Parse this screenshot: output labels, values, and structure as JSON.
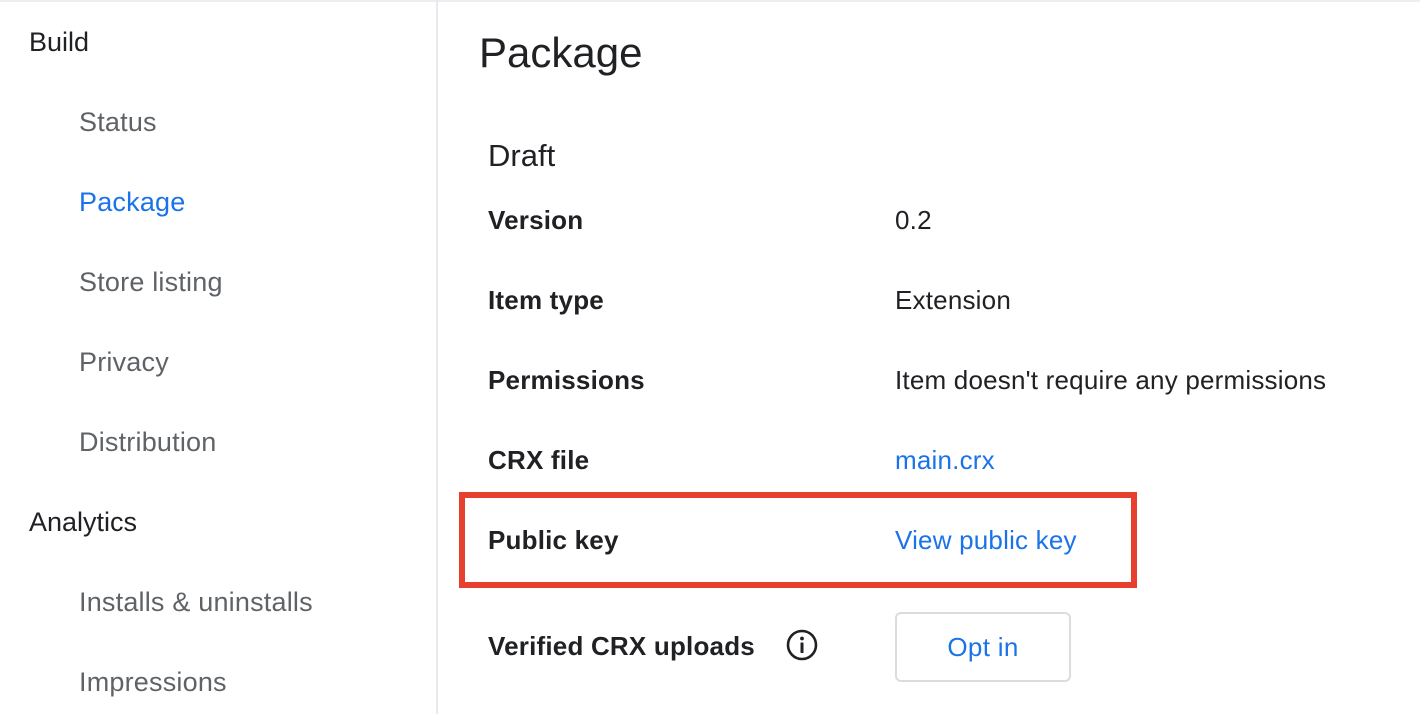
{
  "sidebar": {
    "sections": [
      {
        "label": "Build",
        "items": [
          {
            "label": "Status",
            "active": false
          },
          {
            "label": "Package",
            "active": true
          },
          {
            "label": "Store listing",
            "active": false
          },
          {
            "label": "Privacy",
            "active": false
          },
          {
            "label": "Distribution",
            "active": false
          }
        ]
      },
      {
        "label": "Analytics",
        "items": [
          {
            "label": "Installs & uninstalls",
            "active": false
          },
          {
            "label": "Impressions",
            "active": false
          }
        ]
      }
    ]
  },
  "main": {
    "title": "Package",
    "section_title": "Draft",
    "rows": {
      "version": {
        "label": "Version",
        "value": "0.2"
      },
      "item_type": {
        "label": "Item type",
        "value": "Extension"
      },
      "permissions": {
        "label": "Permissions",
        "value": "Item doesn't require any permissions"
      },
      "crx_file": {
        "label": "CRX file",
        "value": "main.crx"
      },
      "public_key": {
        "label": "Public key",
        "value": "View public key"
      },
      "verified_crx": {
        "label": "Verified CRX uploads",
        "button": "Opt in"
      }
    }
  },
  "icons": {
    "info": "info-icon"
  },
  "colors": {
    "accent": "#1a73e8",
    "highlight": "#e8402e",
    "text": "#202124",
    "muted_text": "#5f6368"
  }
}
